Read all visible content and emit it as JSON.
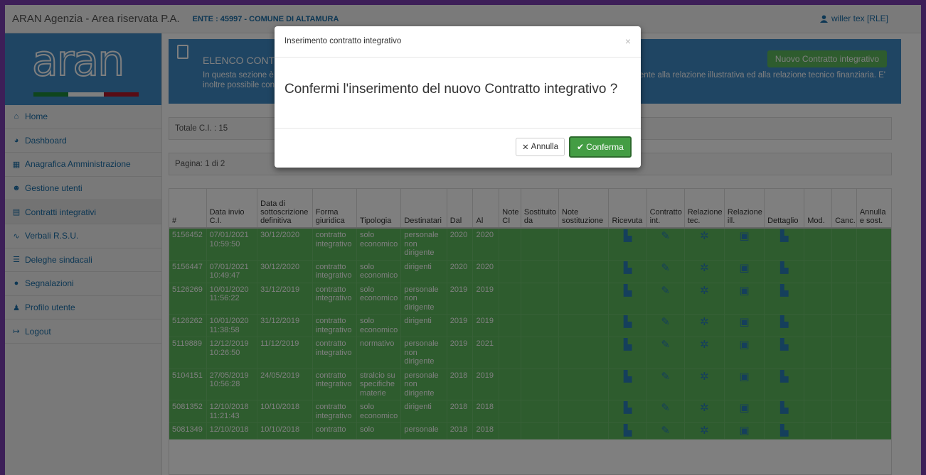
{
  "topbar": {
    "app_title": "ARAN Agenzia - Area riservata P.A.",
    "ente": "ENTE : 45997 - COMUNE DI ALTAMURA",
    "user": "willer tex [RLE]"
  },
  "sidebar": {
    "logo_text": "aran",
    "flag_colors": [
      "#1f8a3a",
      "#ffffff",
      "#b0182a"
    ],
    "items": [
      {
        "label": "Home",
        "icon": "home-icon"
      },
      {
        "label": "Dashboard",
        "icon": "dashboard-icon"
      },
      {
        "label": "Anagrafica Amministrazione",
        "icon": "building-icon"
      },
      {
        "label": "Gestione utenti",
        "icon": "users-icon"
      },
      {
        "label": "Contratti integrativi",
        "icon": "file-icon"
      },
      {
        "label": "Verbali R.S.U.",
        "icon": "signature-icon"
      },
      {
        "label": "Deleghe sindacali",
        "icon": "list-icon"
      },
      {
        "label": "Segnalazioni",
        "icon": "comments-icon"
      },
      {
        "label": "Profilo utente",
        "icon": "user-icon"
      },
      {
        "label": "Logout",
        "icon": "logout-icon"
      }
    ]
  },
  "header": {
    "title": "ELENCO CONTRA",
    "desc_line1_left": "In questa sezione è p",
    "desc_line1_right": "ente alla relazione illustrativa ed alla relazione tecnico finanziaria. E'",
    "desc_line2": "inoltre possibile cons",
    "new_button": "Nuovo Contratto integrativo"
  },
  "totale": "Totale C.I. : 15",
  "pagina": "Pagina: 1 di 2",
  "table": {
    "headers": [
      "#",
      "Data invio C.I.",
      "Data di sottoscrizione definitiva",
      "Forma giuridica",
      "Tipologia",
      "Destinatari",
      "Dal",
      "Al",
      "Note CI",
      "Sostituito da",
      "Note sostituzione",
      "Ricevuta",
      "Contratto int.",
      "Relazione tec.",
      "Relazione ill.",
      "Dettaglio",
      "Mod.",
      "Canc.",
      "Annulla e sost."
    ],
    "rows": [
      {
        "id": "5156452",
        "invio": "07/01/2021 10:59:50",
        "sottoscrizione": "30/12/2020",
        "forma": "contratto integrativo",
        "tipologia": "solo economico",
        "destinatari": "personale non dirigente",
        "dal": "2020",
        "al": "2020"
      },
      {
        "id": "5156447",
        "invio": "07/01/2021 10:49:47",
        "sottoscrizione": "30/12/2020",
        "forma": "contratto integrativo",
        "tipologia": "solo economico",
        "destinatari": "dirigenti",
        "dal": "2020",
        "al": "2020"
      },
      {
        "id": "5126269",
        "invio": "10/01/2020 11:56:22",
        "sottoscrizione": "31/12/2019",
        "forma": "contratto integrativo",
        "tipologia": "solo economico",
        "destinatari": "personale non dirigente",
        "dal": "2019",
        "al": "2019"
      },
      {
        "id": "5126262",
        "invio": "10/01/2020 11:38:58",
        "sottoscrizione": "31/12/2019",
        "forma": "contratto integrativo",
        "tipologia": "solo economico",
        "destinatari": "dirigenti",
        "dal": "2019",
        "al": "2019"
      },
      {
        "id": "5119889",
        "invio": "12/12/2019 10:26:50",
        "sottoscrizione": "11/12/2019",
        "forma": "contratto integrativo",
        "tipologia": "normativo",
        "destinatari": "personale non dirigente",
        "dal": "2019",
        "al": "2021"
      },
      {
        "id": "5104151",
        "invio": "27/05/2019 10:56:28",
        "sottoscrizione": "24/05/2019",
        "forma": "contratto integrativo",
        "tipologia": "stralcio su specifiche materie",
        "destinatari": "personale non dirigente",
        "dal": "2018",
        "al": "2019"
      },
      {
        "id": "5081352",
        "invio": "12/10/2018 11:21:43",
        "sottoscrizione": "10/10/2018",
        "forma": "contratto integrativo",
        "tipologia": "solo economico",
        "destinatari": "dirigenti",
        "dal": "2018",
        "al": "2018"
      },
      {
        "id": "5081349",
        "invio": "12/10/2018",
        "sottoscrizione": "10/10/2018",
        "forma": "contratto",
        "tipologia": "solo",
        "destinatari": "personale",
        "dal": "2018",
        "al": "2018"
      }
    ]
  },
  "modal": {
    "title": "Inserimento contratto integrativo",
    "close": "×",
    "message": "Confermi l'inserimento del nuovo Contratto integrativo ?",
    "cancel_label": "Annulla",
    "confirm_label": "Conferma"
  },
  "colors": {
    "primary": "#3f8ac6",
    "success": "#5cb85c",
    "frame": "#7b3fb0"
  }
}
